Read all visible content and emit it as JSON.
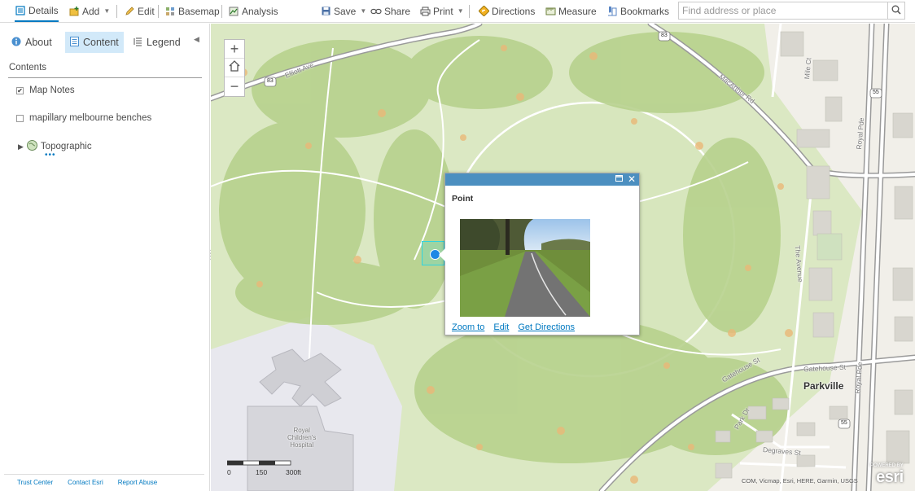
{
  "toolbar": {
    "details": "Details",
    "add": "Add",
    "edit": "Edit",
    "basemap": "Basemap",
    "analysis": "Analysis",
    "save": "Save",
    "share": "Share",
    "print": "Print",
    "directions": "Directions",
    "measure": "Measure",
    "bookmarks": "Bookmarks",
    "search_placeholder": "Find address or place"
  },
  "sidebar": {
    "tabs": {
      "about": "About",
      "content": "Content",
      "legend": "Legend"
    },
    "contents_title": "Contents",
    "layers": [
      {
        "label": "Map Notes",
        "checked": true
      },
      {
        "label": "mapillary melbourne benches",
        "checked": false
      }
    ],
    "basemap_layer": "Topographic",
    "footer": {
      "trust": "Trust Center",
      "contact": "Contact Esri",
      "report": "Report Abuse"
    }
  },
  "map": {
    "labels": {
      "elliott_ave": "Elliott Ave",
      "macarthur_rd": "MacArthur Rd",
      "royal_pde_1": "Royal Pde",
      "royal_pde_2": "Royal Pde",
      "the_avenue": "The Avenue",
      "gatehouse_st_1": "Gatehouse St",
      "gatehouse_st_2": "Gatehouse St",
      "parkville": "Parkville",
      "hospital": "Royal Children's Hospital",
      "degraves_st": "Degraves St",
      "park_dr": "Park Dr",
      "hospital_line1": "Royal",
      "hospital_line2": "Children's",
      "hospital_line3": "Hospital",
      "route_83a": "83",
      "route_83b": "83",
      "route_55a": "55",
      "route_55b": "55",
      "mile_ct": "Mile Ct"
    },
    "scale": {
      "a": "0",
      "b": "150",
      "c": "300ft"
    },
    "attribution": "COM, Vicmap, Esri, HERE, Garmin, USGS",
    "powered_by": "POWERED BY",
    "esri": "esri"
  },
  "popup": {
    "title": "Point",
    "zoom_to": "Zoom to",
    "edit": "Edit",
    "get_directions": "Get Directions"
  },
  "colors": {
    "accent": "#0079c1",
    "popup_header": "#4c8fc0",
    "park_green": "#dde9c6",
    "tree_green": "#b9d391",
    "tree_orange": "#eab878"
  }
}
